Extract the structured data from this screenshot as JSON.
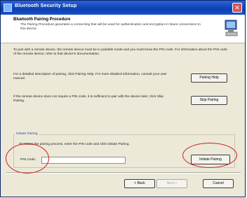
{
  "window": {
    "title": "Bluetooth Security Setup"
  },
  "header": {
    "title": "Bluetooth Pairing Procedure",
    "description": "The Pairing Procedure generates a connecting that will be used for authentication and encryption in future connections to this device."
  },
  "body": {
    "para1": "To pair with a remote device, the remote device must be in pairable mode and you must know the PIN code. For information about the PIN code of the remote device, refer to that device's documentation.",
    "para2": "For a detailed description of pairing, click Pairing Help. For more detailed information, consult your user manual.",
    "para3": "If the remote device does not require a PIN code, it is sufficient to pair with the device later, click Skip Pairing.",
    "pairing_help_label": "Pairing Help",
    "skip_pairing_label": "Skip Pairing"
  },
  "initiate_group": {
    "title": "Initiate Pairing",
    "instruction": "To initiate the pairing process, enter the PIN code and click Initiate Pairing.",
    "pin_label": "PIN Code:",
    "pin_value": "",
    "initiate_label": "Initiate Pairing"
  },
  "footer": {
    "back_label": "< Back",
    "next_label": "Next >",
    "cancel_label": "Cancel"
  },
  "colors": {
    "annotation": "#d21a1a",
    "title_bar": "#0b3fb3",
    "panel": "#ece9d8"
  }
}
